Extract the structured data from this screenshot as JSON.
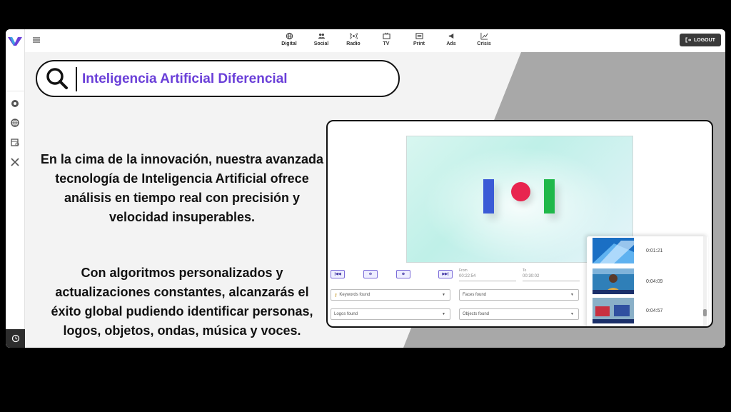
{
  "topbar": {
    "nav": [
      {
        "label": "Digital",
        "icon": "globe-icon"
      },
      {
        "label": "Social",
        "icon": "people-icon"
      },
      {
        "label": "Radio",
        "icon": "radio-icon"
      },
      {
        "label": "TV",
        "icon": "tv-icon"
      },
      {
        "label": "Print",
        "icon": "newspaper-icon"
      },
      {
        "label": "Ads",
        "icon": "megaphone-icon"
      },
      {
        "label": "Crisis",
        "icon": "chart-icon"
      }
    ],
    "logout_label": "LOGOUT"
  },
  "sidebar": {
    "icons": [
      "dashboard-icon",
      "globe-settings-icon",
      "calendar-search-icon",
      "tools-icon"
    ],
    "bottom_icon": "history-icon"
  },
  "hero": {
    "title": "Inteligencia Artificial Diferencial",
    "paragraph1": "En la cima de la innovación, nuestra avanzada tecnología de Inteligencia Artificial ofrece análisis en tiempo real con precisión y velocidad insuperables.",
    "paragraph2": "Con algoritmos personalizados y actualizaciones constantes, alcanzarás el éxito global pudiendo identificar personas, logos, objetos, ondas, música y voces."
  },
  "player": {
    "controls": {
      "prev": "|◀◀",
      "zoom_out": "⊖",
      "zoom_in": "⊕",
      "next": "▶▶|"
    },
    "from": {
      "label": "From",
      "value": "00:22:54"
    },
    "to": {
      "label": "To",
      "value": "00:30:02"
    },
    "filters": {
      "keywords": "Keywords found",
      "faces": "Faces found",
      "logos": "Logos found",
      "objects": "Objects found"
    },
    "clips": [
      {
        "time": "0:01:21"
      },
      {
        "time": "0:04:09"
      },
      {
        "time": "0:04:57"
      }
    ]
  },
  "colors": {
    "accent": "#6a3fd8",
    "logout_bg": "#3a3a3a"
  }
}
